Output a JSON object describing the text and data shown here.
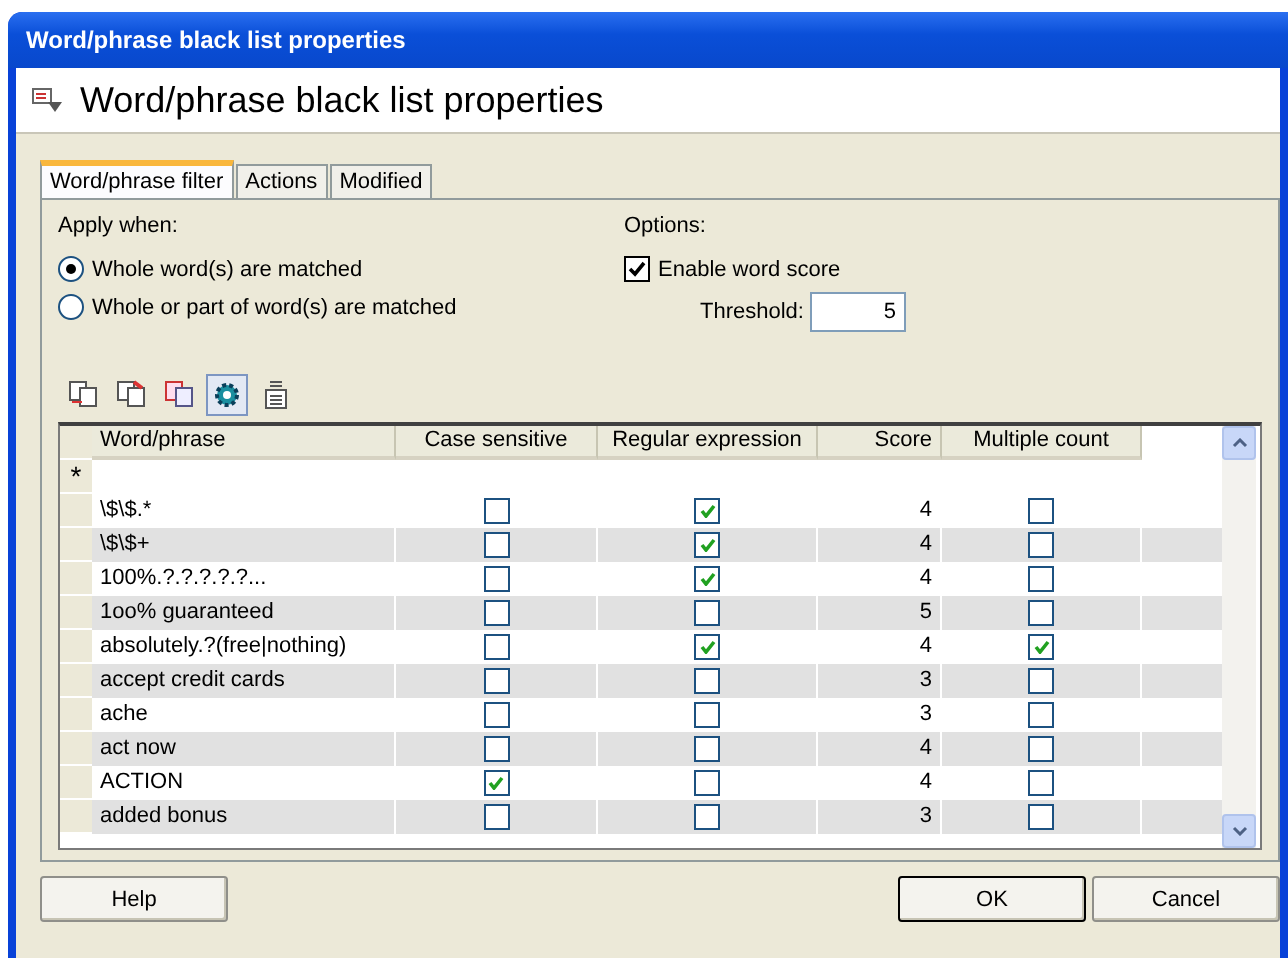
{
  "window": {
    "title": "Word/phrase black list properties"
  },
  "header": {
    "title": "Word/phrase black list properties"
  },
  "tabs": [
    {
      "label": "Word/phrase filter",
      "selected": true
    },
    {
      "label": "Actions",
      "selected": false
    },
    {
      "label": "Modified",
      "selected": false
    }
  ],
  "apply_when": {
    "label": "Apply when:",
    "options": [
      {
        "label": "Whole word(s) are matched",
        "selected": true
      },
      {
        "label": "Whole or part of word(s) are matched",
        "selected": false
      }
    ]
  },
  "options": {
    "label": "Options:",
    "enable_word_score": {
      "label": "Enable word score",
      "checked": true
    },
    "threshold": {
      "label": "Threshold:",
      "value": "5"
    }
  },
  "toolbar": [
    {
      "kind": "add",
      "pressed": false
    },
    {
      "kind": "delete",
      "pressed": false
    },
    {
      "kind": "copy",
      "pressed": false
    },
    {
      "kind": "settings",
      "pressed": true
    },
    {
      "kind": "spelling",
      "pressed": false
    }
  ],
  "table": {
    "columns": [
      "Word/phrase",
      "Case sensitive",
      "Regular expression",
      "Score",
      "Multiple count"
    ],
    "new_row_marker": "*",
    "rows": [
      {
        "word": "\\$\\$.*",
        "case_sensitive": false,
        "regex": true,
        "score": "4",
        "multiple": false
      },
      {
        "word": "\\$\\$+",
        "case_sensitive": false,
        "regex": true,
        "score": "4",
        "multiple": false
      },
      {
        "word": "100%.?.?.?.?.?...",
        "case_sensitive": false,
        "regex": true,
        "score": "4",
        "multiple": false
      },
      {
        "word": "1oo% guaranteed",
        "case_sensitive": false,
        "regex": false,
        "score": "5",
        "multiple": false
      },
      {
        "word": "absolutely.?(free|nothing)",
        "case_sensitive": false,
        "regex": true,
        "score": "4",
        "multiple": true
      },
      {
        "word": "accept credit cards",
        "case_sensitive": false,
        "regex": false,
        "score": "3",
        "multiple": false
      },
      {
        "word": "ache",
        "case_sensitive": false,
        "regex": false,
        "score": "3",
        "multiple": false
      },
      {
        "word": "act now",
        "case_sensitive": false,
        "regex": false,
        "score": "4",
        "multiple": false
      },
      {
        "word": "ACTION",
        "case_sensitive": true,
        "regex": false,
        "score": "4",
        "multiple": false
      },
      {
        "word": "added bonus",
        "case_sensitive": false,
        "regex": false,
        "score": "3",
        "multiple": false
      }
    ]
  },
  "buttons": [
    {
      "label": "Help",
      "kind": "left"
    },
    {
      "label": "OK",
      "kind": "default"
    },
    {
      "label": "Cancel",
      "kind": "normal"
    }
  ]
}
